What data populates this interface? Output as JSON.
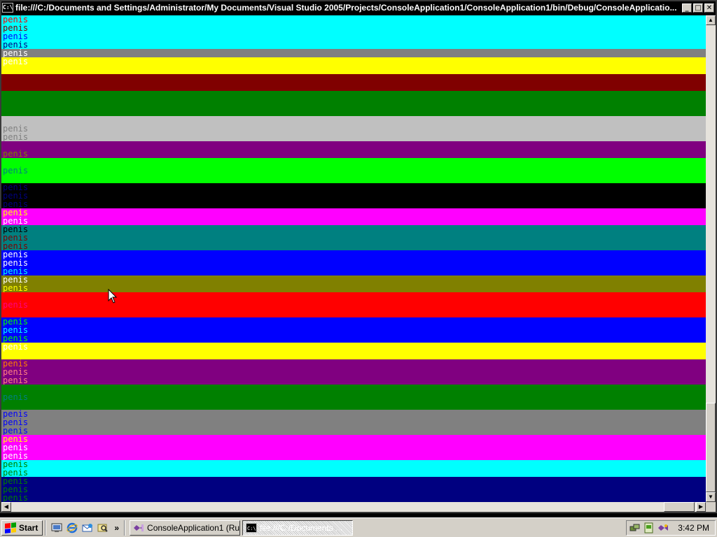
{
  "window": {
    "title": "file:///C:/Documents and Settings/Administrator/My Documents/Visual Studio 2005/Projects/ConsoleApplication1/ConsoleApplication1/bin/Debug/ConsoleApplicatio...",
    "icon_text": "C:\\",
    "minimize_label": "_",
    "maximize_label": "□",
    "close_label": "✕"
  },
  "console": {
    "word": "penis",
    "bands": [
      {
        "bg": "#00ffff",
        "lines": [
          "#ff0000",
          "#800000",
          "#0000ff",
          "#000080"
        ]
      },
      {
        "bg": "#808080",
        "lines": [
          "#ffffff"
        ]
      },
      {
        "bg": "#ffff00",
        "lines": [
          "#ffffff",
          "#ffff00"
        ]
      },
      {
        "bg": "#800000",
        "lines": [
          "#800000",
          "#800000"
        ]
      },
      {
        "bg": "#008000",
        "lines": [
          "#008000",
          "#008000",
          "#008000"
        ]
      },
      {
        "bg": "#c0c0c0",
        "lines": [
          "#c0c0c0",
          "#808080",
          "#808080"
        ]
      },
      {
        "bg": "#800080",
        "lines": [
          "#800080",
          "#808000"
        ]
      },
      {
        "bg": "#00ff00",
        "lines": [
          "#00ff00",
          "#008080",
          "#00ff00"
        ]
      },
      {
        "bg": "#000000",
        "lines": [
          "#000080",
          "#000080",
          "#000080"
        ]
      },
      {
        "bg": "#ff00ff",
        "lines": [
          "#ffff00",
          "#ffffff"
        ]
      },
      {
        "bg": "#008080",
        "lines": [
          "#000000",
          "#800000",
          "#800000"
        ]
      },
      {
        "bg": "#0000ff",
        "lines": [
          "#ffffff",
          "#ffffff",
          "#00ffff"
        ]
      },
      {
        "bg": "#808000",
        "lines": [
          "#ffffff",
          "#ffff00"
        ]
      },
      {
        "bg": "#ff0000",
        "lines": [
          "#ff0000",
          "#ff0080",
          "#ff0000"
        ]
      },
      {
        "bg": "#0000ff",
        "lines": [
          "#00ff00",
          "#00ffff",
          "#00ff00"
        ]
      },
      {
        "bg": "#ffff00",
        "lines": [
          "#ffffff",
          "#ffff00"
        ]
      },
      {
        "bg": "#800080",
        "lines": [
          "#ff8000",
          "#ff8080",
          "#ff8080"
        ]
      },
      {
        "bg": "#008000",
        "lines": [
          "#008000",
          "#008080",
          "#008000"
        ]
      },
      {
        "bg": "#808080",
        "lines": [
          "#0000ff",
          "#0000ff",
          "#0000ff"
        ]
      },
      {
        "bg": "#ff00ff",
        "lines": [
          "#ffff00",
          "#ffffff",
          "#ffffff"
        ]
      },
      {
        "bg": "#00ffff",
        "lines": [
          "#008000",
          "#008000"
        ]
      },
      {
        "bg": "#000080",
        "lines": [
          "#008000",
          "#008000",
          "#008000"
        ]
      }
    ]
  },
  "taskbar": {
    "start_label": "Start",
    "quick_launch_more": "»",
    "tasks": [
      {
        "label": "ConsoleApplication1 (Run...",
        "active": false
      },
      {
        "label": "file:///C:/Documents ...",
        "active": true
      }
    ],
    "clock": "3:42 PM"
  },
  "colors": {
    "taskbar_bg": "#d4d0c8",
    "win_logo": [
      "#ff0000",
      "#00a000",
      "#0000ff",
      "#ffcc00"
    ]
  }
}
